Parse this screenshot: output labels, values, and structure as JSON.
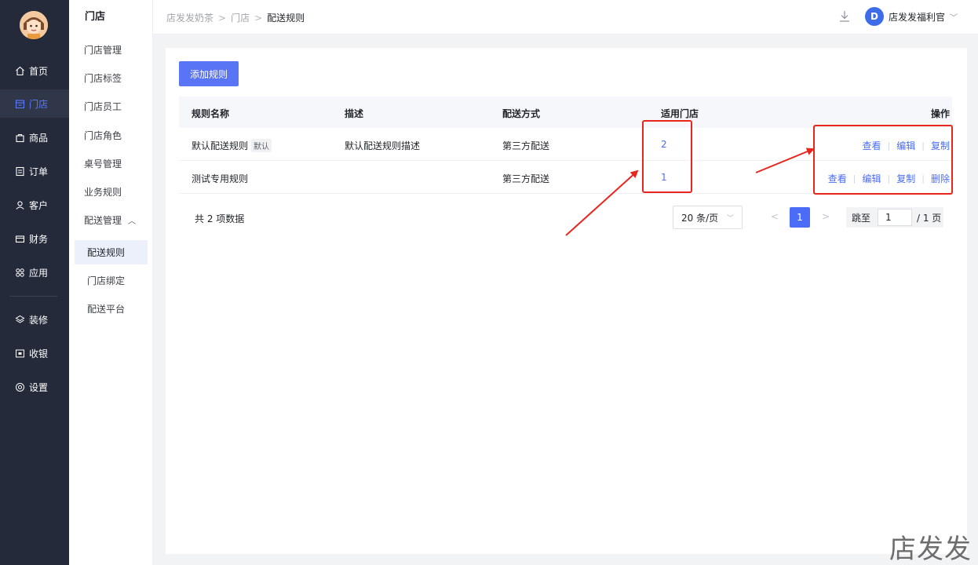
{
  "rail": {
    "items": [
      {
        "label": "首页",
        "icon": "home-icon"
      },
      {
        "label": "门店",
        "icon": "store-icon"
      },
      {
        "label": "商品",
        "icon": "bag-icon"
      },
      {
        "label": "订单",
        "icon": "order-icon"
      },
      {
        "label": "客户",
        "icon": "user-icon"
      },
      {
        "label": "财务",
        "icon": "wallet-icon"
      },
      {
        "label": "应用",
        "icon": "apps-icon"
      },
      {
        "label": "装修",
        "icon": "layers-icon"
      },
      {
        "label": "收银",
        "icon": "cashier-icon"
      },
      {
        "label": "设置",
        "icon": "settings-icon"
      }
    ],
    "active_index": 1
  },
  "submenu": {
    "title": "门店",
    "items": [
      "门店管理",
      "门店标签",
      "门店员工",
      "门店角色",
      "桌号管理",
      "业务规则",
      "配送管理"
    ],
    "children": [
      "配送规则",
      "门店绑定",
      "配送平台"
    ],
    "active_child": "配送规则"
  },
  "topbar": {
    "breadcrumb": [
      "店发发奶茶",
      "门店",
      "配送规则"
    ],
    "user_name": "店发发福利官",
    "user_initial": "D"
  },
  "main": {
    "add_button": "添加规则",
    "columns": [
      "规则名称",
      "描述",
      "配送方式",
      "适用门店",
      "操作"
    ],
    "rows": [
      {
        "name": "默认配送规则",
        "tag": "默认",
        "desc": "默认配送规则描述",
        "method": "第三方配送",
        "stores": "2",
        "ops": [
          "查看",
          "编辑",
          "复制"
        ]
      },
      {
        "name": "测试专用规则",
        "tag": "",
        "desc": "",
        "method": "第三方配送",
        "stores": "1",
        "ops": [
          "查看",
          "编辑",
          "复制",
          "删除"
        ]
      }
    ],
    "pagination": {
      "total_text": "共 2 项数据",
      "page_size": "20 条/页",
      "current_page": "1",
      "jump_label": "跳至",
      "jump_value": "1",
      "total_pages_text": "/ 1 页"
    }
  },
  "annotation_color": "#e8261d",
  "watermark": "店发发"
}
